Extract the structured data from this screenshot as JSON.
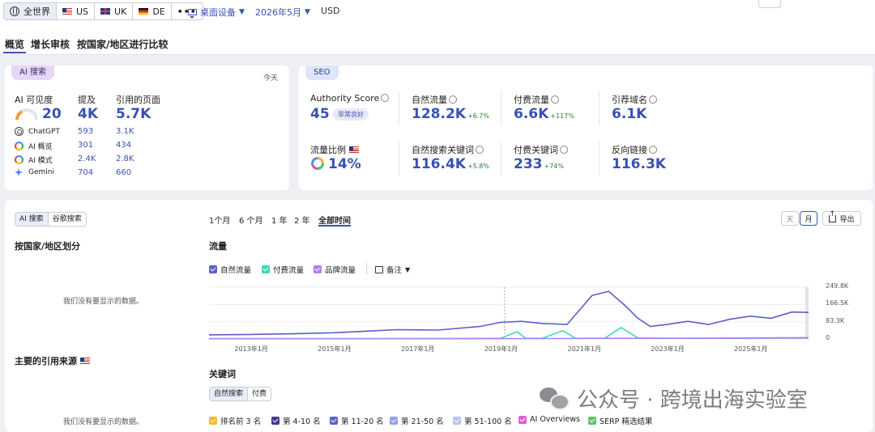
{
  "topbar": {
    "regions": [
      {
        "label": "全世界",
        "icon": "globe-icon",
        "active": true
      },
      {
        "label": "US",
        "icon": "flag-us-icon"
      },
      {
        "label": "UK",
        "icon": "flag-uk-icon"
      },
      {
        "label": "DE",
        "icon": "flag-de-icon"
      }
    ],
    "more": "•••",
    "device": "桌面设备",
    "date": "2026年5月",
    "currency": "USD"
  },
  "tabs": [
    "概览",
    "增长审核",
    "按国家/地区进行比较"
  ],
  "ai_card": {
    "pill": "AI 搜索",
    "today": "今天",
    "visibility_label": "AI 可见度",
    "visibility_value": "20",
    "mentions_label": "提及",
    "mentions_value": "4K",
    "cited_label": "引用的页面",
    "cited_value": "5.7K",
    "rows": [
      {
        "name": "ChatGPT",
        "mentions": "593",
        "cited": "3.1K"
      },
      {
        "name": "AI 概览",
        "mentions": "301",
        "cited": "434"
      },
      {
        "name": "AI 模式",
        "mentions": "2.4K",
        "cited": "2.8K"
      },
      {
        "name": "Gemini",
        "mentions": "704",
        "cited": "660"
      }
    ]
  },
  "seo_card": {
    "pill": "SEO",
    "authority_label": "Authority Score",
    "authority_value": "45",
    "authority_badge": "非常良好",
    "organic_label": "自然流量",
    "organic_value": "128.2K",
    "organic_delta": "+6.7%",
    "paid_label": "付费流量",
    "paid_value": "6.6K",
    "paid_delta": "+117%",
    "refdomains_label": "引荐域名",
    "refdomains_value": "6.1K",
    "share_label": "流量比例",
    "share_value": "14%",
    "organic_kw_label": "自然搜索关键词",
    "organic_kw_value": "116.4K",
    "organic_kw_delta": "+5.8%",
    "paid_kw_label": "付费关键词",
    "paid_kw_value": "233",
    "paid_kw_delta": "+74%",
    "backlinks_label": "反向链接",
    "backlinks_value": "116.3K"
  },
  "main": {
    "left_tabs": [
      "AI 搜索",
      "谷歌搜索"
    ],
    "country_title": "按国家/地区划分",
    "nodata1": "我们没有要显示的数据。",
    "sources_title": "主要的引用来源",
    "nodata2": "我们没有要显示的数据。",
    "ranges": [
      "1个月",
      "6 个月",
      "1 年",
      "2 年",
      "全部时间"
    ],
    "day_btn": "天",
    "month_btn": "月",
    "export_btn": "导出",
    "traffic_title": "流量",
    "legend": [
      {
        "label": "自然流量",
        "color": "#5b5fc7"
      },
      {
        "label": "付费流量",
        "color": "#3ed9b4"
      },
      {
        "label": "品牌流量",
        "color": "#b57ef0"
      }
    ],
    "notes_label": "备注",
    "keywords_title": "关键词",
    "kw_tabs": [
      "自然搜索",
      "付费"
    ],
    "kw_legend": [
      {
        "label": "排名前 3 名",
        "color": "#f5b82e"
      },
      {
        "label": "第 4-10 名",
        "color": "#3f3a8f"
      },
      {
        "label": "第 11-20 名",
        "color": "#5a63c9"
      },
      {
        "label": "第 21-50 名",
        "color": "#8fa0e8"
      },
      {
        "label": "第 51-100 名",
        "color": "#b7c3f1"
      },
      {
        "label": "AI Overviews",
        "color": "#e25bd6"
      },
      {
        "label": "SERP 精选结果",
        "color": "#5cc36a"
      }
    ]
  },
  "chart_data": {
    "type": "line",
    "title": "流量",
    "x_ticks": [
      "2013年1月",
      "2015年1月",
      "2017年1月",
      "2019年1月",
      "2021年1月",
      "2023年1月",
      "2025年1月"
    ],
    "y_ticks": [
      "249.8K",
      "166.5K",
      "83.3K",
      "0"
    ],
    "ylim": [
      0,
      249800
    ],
    "xlim": [
      2012.0,
      2026.4
    ],
    "series": [
      {
        "name": "自然流量",
        "color": "#5b5fc7",
        "points": [
          [
            2012.0,
            20000
          ],
          [
            2013.0,
            22000
          ],
          [
            2014.0,
            25000
          ],
          [
            2015.0,
            30000
          ],
          [
            2016.0,
            40000
          ],
          [
            2016.5,
            45000
          ],
          [
            2017.5,
            43000
          ],
          [
            2018.5,
            60000
          ],
          [
            2019.0,
            80000
          ],
          [
            2019.5,
            85000
          ],
          [
            2020.0,
            75000
          ],
          [
            2020.6,
            70000
          ],
          [
            2020.9,
            140000
          ],
          [
            2021.2,
            210000
          ],
          [
            2021.6,
            230000
          ],
          [
            2022.0,
            160000
          ],
          [
            2022.3,
            100000
          ],
          [
            2022.6,
            60000
          ],
          [
            2023.0,
            70000
          ],
          [
            2023.5,
            85000
          ],
          [
            2024.0,
            70000
          ],
          [
            2024.5,
            95000
          ],
          [
            2025.0,
            110000
          ],
          [
            2025.5,
            100000
          ],
          [
            2026.0,
            130000
          ],
          [
            2026.4,
            128200
          ]
        ]
      },
      {
        "name": "付费流量",
        "color": "#3ed9b4",
        "points": [
          [
            2012.0,
            1000
          ],
          [
            2016.0,
            1000
          ],
          [
            2018.0,
            2000
          ],
          [
            2019.0,
            3000
          ],
          [
            2019.4,
            35000
          ],
          [
            2019.6,
            3000
          ],
          [
            2020.0,
            3000
          ],
          [
            2020.5,
            40000
          ],
          [
            2020.8,
            3000
          ],
          [
            2021.5,
            3000
          ],
          [
            2021.9,
            55000
          ],
          [
            2022.3,
            5000
          ],
          [
            2023.0,
            3000
          ],
          [
            2024.0,
            4000
          ],
          [
            2025.0,
            5000
          ],
          [
            2026.4,
            6600
          ]
        ]
      },
      {
        "name": "品牌流量",
        "color": "#b57ef0",
        "points": [
          [
            2012.0,
            1000
          ],
          [
            2020.0,
            2000
          ],
          [
            2022.0,
            3000
          ],
          [
            2024.0,
            3000
          ],
          [
            2026.4,
            4000
          ]
        ]
      }
    ]
  },
  "watermark": "公众号 · 跨境出海实验室"
}
